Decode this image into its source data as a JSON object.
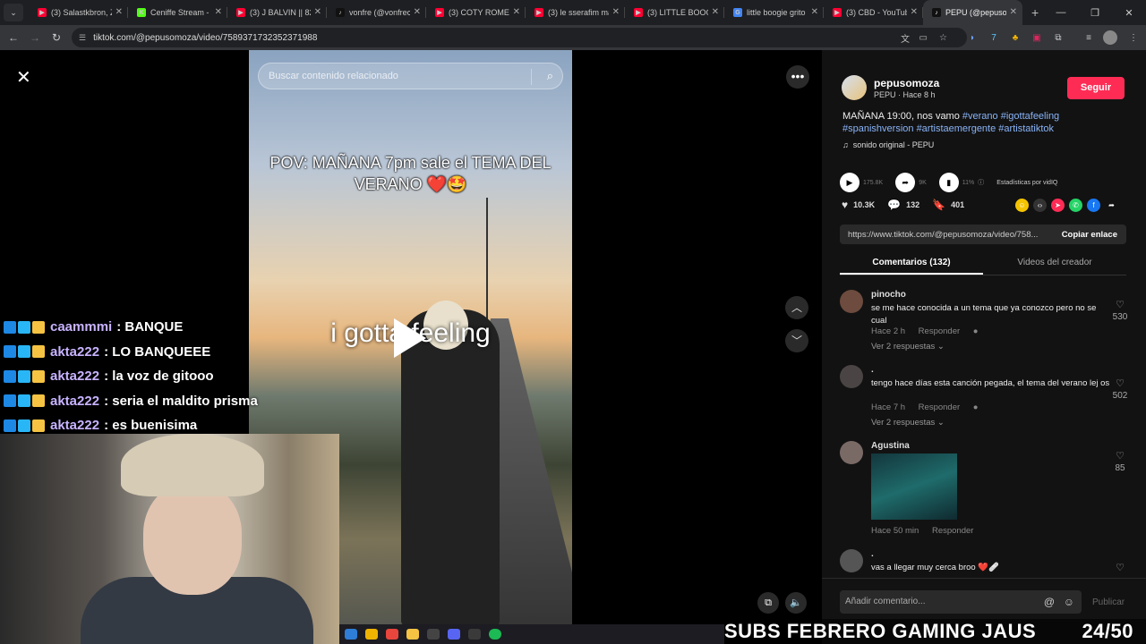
{
  "browser": {
    "tabs": [
      {
        "title": "(3) Salastkbron, Za",
        "color": "#ff0033",
        "glyph": "▶"
      },
      {
        "title": "Ceniffe Stream - W",
        "color": "#53fc18",
        "glyph": "K"
      },
      {
        "title": "(3) J BALVIN || 82",
        "color": "#ff0033",
        "glyph": "▶"
      },
      {
        "title": "vonfre (@vonfrec",
        "color": "#111111",
        "glyph": "♪"
      },
      {
        "title": "(3) COTY ROMERO",
        "color": "#ff0033",
        "glyph": "▶"
      },
      {
        "title": "(3) le sserafim ma",
        "color": "#ff0033",
        "glyph": "▶"
      },
      {
        "title": "(3) LITTLE BOOGIE",
        "color": "#ff0033",
        "glyph": "▶"
      },
      {
        "title": "little boogie grito",
        "color": "#4285f4",
        "glyph": "G"
      },
      {
        "title": "(3) CBD - YouTub",
        "color": "#ff0033",
        "glyph": "▶"
      },
      {
        "title": "PEPU (@pepusom",
        "color": "#111111",
        "glyph": "♪",
        "active": true
      }
    ],
    "url": "tiktok.com/@pepusomoza/video/7589371732352371988"
  },
  "video": {
    "search_placeholder": "Buscar contenido relacionado",
    "caption": "POV: MAÑANA 7pm sale el TEMA DEL VERANO ❤️🤩",
    "title_overlay": "i gotta feeling"
  },
  "chat": [
    {
      "user": "caammmi",
      "message": ": BANQUE"
    },
    {
      "user": "akta222",
      "message": ": LO BANQUEEE"
    },
    {
      "user": "akta222",
      "message": ": la voz de gitooo"
    },
    {
      "user": "akta222",
      "message": ": seria el maldito prisma"
    },
    {
      "user": "akta222",
      "message": ": es buenisima"
    }
  ],
  "creator": {
    "username": "pepusomoza",
    "meta": "PEPU · Hace 8 h",
    "follow_label": "Seguir",
    "description_text": "MAÑANA 19:00, nos vamo ",
    "hashtags": [
      "#verano",
      "#igottafeeling",
      "#spanishversion",
      "#artistaemergente",
      "#artistatiktok"
    ],
    "sound": "sonido original - PEPU"
  },
  "stats": {
    "plays": "175.8K",
    "shares_stat": "9K",
    "engagement": "11%",
    "vidiq_label": "Estadísticas por vidIQ"
  },
  "actions": {
    "likes": "10.3K",
    "comments": "132",
    "saves": "401"
  },
  "link": {
    "url": "https://www.tiktok.com/@pepusomoza/video/758...",
    "copy_label": "Copiar enlace"
  },
  "panel_tabs": {
    "comments": "Comentarios (132)",
    "creator_videos": "Videos del creador"
  },
  "comments": [
    {
      "user": "pinocho",
      "text": "se me hace conocida a un tema que ya conozco pero no se cual",
      "time": "Hace 2 h",
      "reply": "Responder",
      "replies": "Ver 2 respuestas ⌄",
      "likes": "530"
    },
    {
      "user": ".",
      "text": "tengo hace días esta canción pegada, el tema del verano lej os",
      "time": "Hace 7 h",
      "reply": "Responder",
      "replies": "Ver 2 respuestas ⌄",
      "likes": "502"
    },
    {
      "user": "Agustina",
      "text": "",
      "time": "Hace 50 min",
      "reply": "Responder",
      "replies": "",
      "likes": "85"
    },
    {
      "user": ".",
      "text": "vas a llegar muy cerca broo ❤️🩹",
      "time": "",
      "reply": "",
      "replies": "",
      "likes": ""
    }
  ],
  "comment_input": {
    "placeholder": "Añadir comentario...",
    "publish_label": "Publicar"
  },
  "overlay": {
    "subs_text": "SUBS FEBRERO GAMING JAUS",
    "subs_count": "24/50"
  }
}
